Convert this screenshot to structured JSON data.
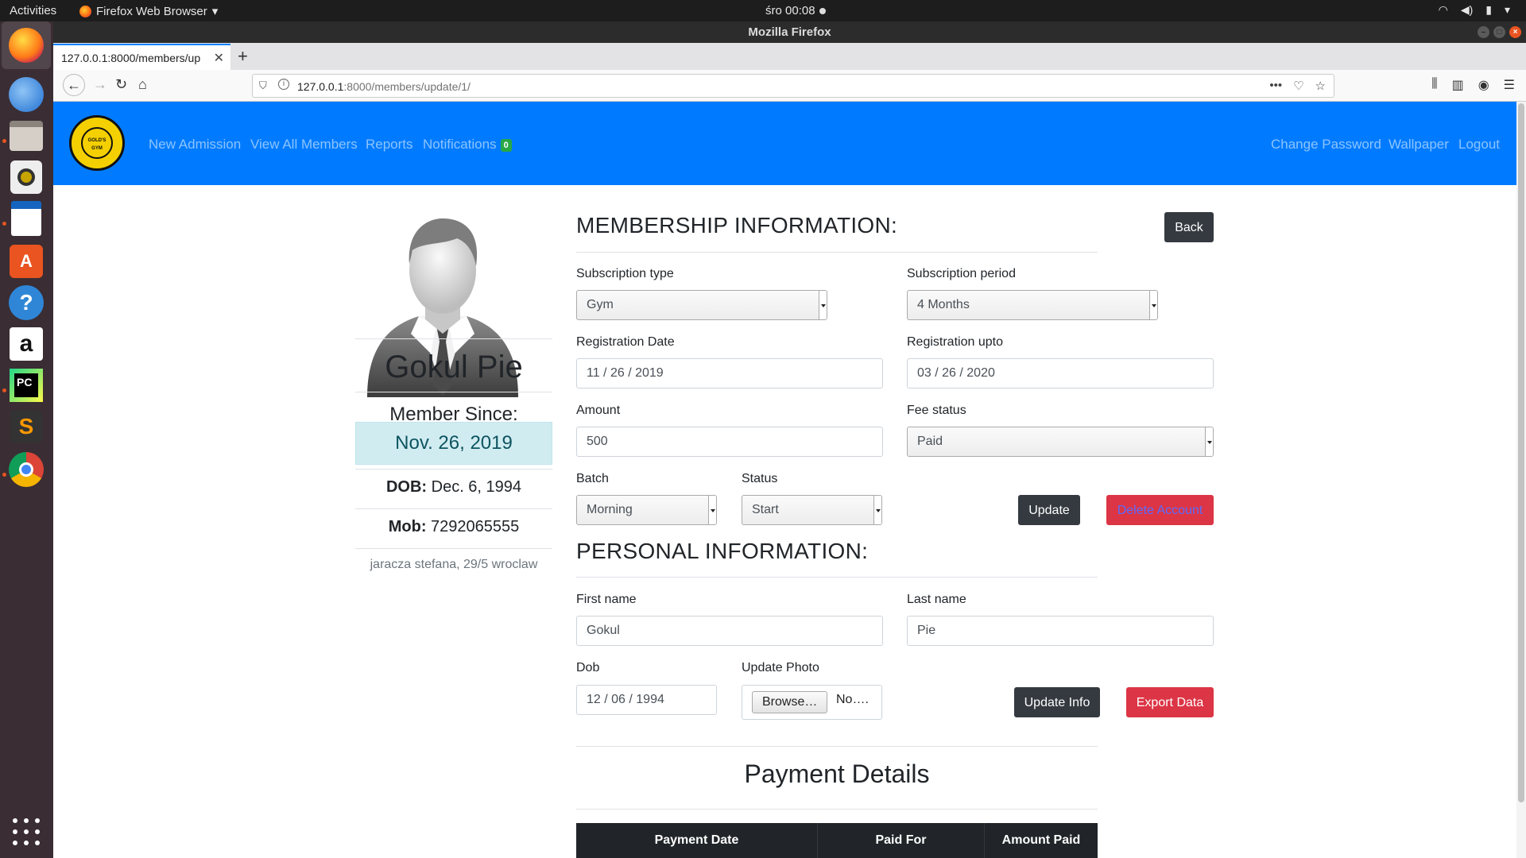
{
  "system": {
    "activities": "Activities",
    "app_menu": "Firefox Web Browser",
    "clock": "śro 00:08",
    "window_title": "Mozilla Firefox"
  },
  "browser": {
    "tab_title": "127.0.0.1:8000/members/up",
    "url_host": "127.0.0.1",
    "url_path": ":8000/members/update/1/"
  },
  "site_nav": {
    "logo_text": "GOLD'S GYM",
    "links": [
      "New Admission",
      "View All Members",
      "Reports",
      "Notifications"
    ],
    "notification_count": "0",
    "right_links": [
      "Change Password",
      "Wallpaper",
      "Logout"
    ]
  },
  "profile": {
    "name": "Gokul Pie",
    "member_since_label": "Member Since:",
    "member_since": "Nov. 26, 2019",
    "dob_label": "DOB:",
    "dob": "Dec. 6, 1994",
    "mob_label": "Mob:",
    "mob": "7292065555",
    "address": "jaracza stefana, 29/5 wroclaw"
  },
  "membership": {
    "title": "MEMBERSHIP INFORMATION:",
    "back": "Back",
    "subscription_type_label": "Subscription type",
    "subscription_type": "Gym",
    "subscription_period_label": "Subscription period",
    "subscription_period": "4 Months",
    "registration_date_label": "Registration Date",
    "registration_date": "11 / 26 / 2019",
    "registration_upto_label": "Registration upto",
    "registration_upto": "03 / 26 / 2020",
    "amount_label": "Amount",
    "amount": "500",
    "fee_status_label": "Fee status",
    "fee_status": "Paid",
    "batch_label": "Batch",
    "batch": "Morning",
    "status_label": "Status",
    "status": "Start",
    "update": "Update",
    "delete": "Delete Account"
  },
  "personal": {
    "title": "PERSONAL INFORMATION:",
    "first_name_label": "First name",
    "first_name": "Gokul",
    "last_name_label": "Last name",
    "last_name": "Pie",
    "dob_label": "Dob",
    "dob": "12 / 06 / 1994",
    "photo_label": "Update Photo",
    "browse": "Browse…",
    "no_file": "No….",
    "update_info": "Update Info",
    "export": "Export Data"
  },
  "payments": {
    "title": "Payment Details",
    "columns": [
      "Payment Date",
      "Paid For",
      "Amount Paid"
    ]
  },
  "colors": {
    "nav_blue": "#007bff",
    "danger": "#dc3545",
    "dark": "#343a40",
    "info_bg": "#d1ecf1"
  }
}
